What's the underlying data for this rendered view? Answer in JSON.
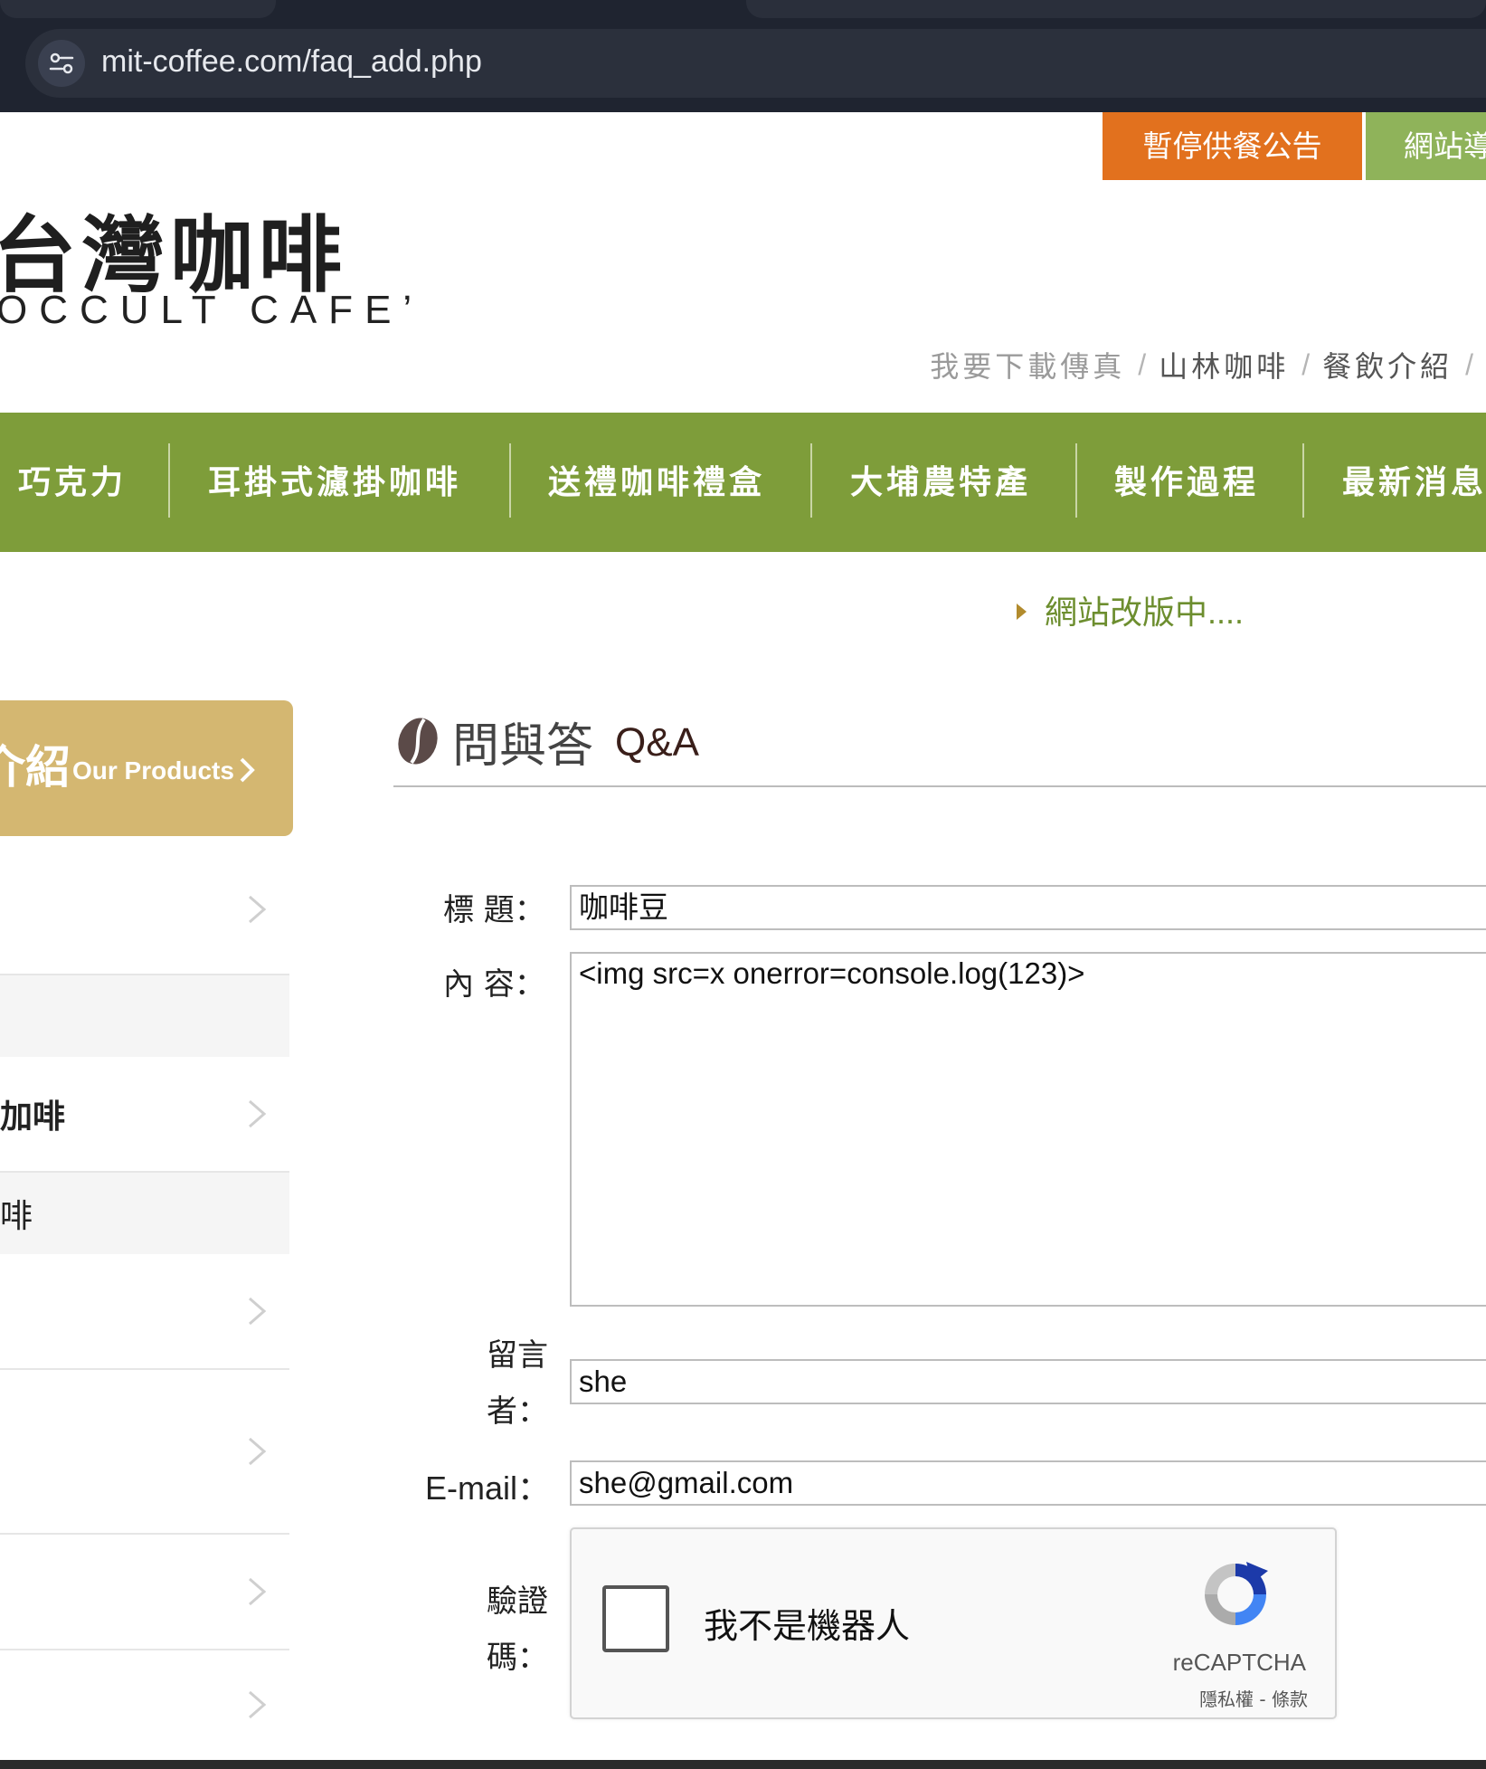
{
  "browser": {
    "url": "mit-coffee.com/faq_add.php"
  },
  "top_buttons": {
    "notice": "暫停供餐公告",
    "guide": "網站導"
  },
  "logo": {
    "cn": "台灣咖啡",
    "en": "OCCULT CAFE’"
  },
  "sub_links": [
    "我要下載傳真",
    "山林咖啡",
    "餐飲介紹"
  ],
  "sub_link_separator": "/",
  "nav": {
    "items": [
      "巧克力",
      "耳掛式濾掛咖啡",
      "送禮咖啡禮盒",
      "大埔農特產",
      "製作過程",
      "最新消息"
    ]
  },
  "marquee": {
    "text": "網站改版中...."
  },
  "sidebar": {
    "header_cn": "介紹",
    "header_en": "Our Products",
    "items": [
      {
        "label": ""
      },
      {
        "label": ""
      },
      {
        "label": "加啡"
      },
      {
        "label": "啡"
      },
      {
        "label": ""
      },
      {
        "label": ""
      },
      {
        "label": ""
      },
      {
        "label": ""
      }
    ]
  },
  "page": {
    "title_cn": "問與答",
    "title_en": "Q&A"
  },
  "form": {
    "title_label": "標 題：",
    "title_value": "咖啡豆",
    "content_label": "內 容：",
    "content_value": "<img src=x onerror=console.log(123)>",
    "author_label_line1": "留言",
    "author_label_line2": "者：",
    "author_value": "she",
    "email_label": "E-mail：",
    "email_value": "she@gmail.com",
    "captcha_label_line1": "驗證",
    "captcha_label_line2": "碼："
  },
  "recaptcha": {
    "label": "我不是機器人",
    "brand": "reCAPTCHA",
    "links": "隱私權 - 條款"
  },
  "colors": {
    "nav_green": "#7e9d3a",
    "notice_orange": "#e2711e",
    "guide_green": "#8fb35a",
    "sidebar_gold": "#d4b771"
  }
}
